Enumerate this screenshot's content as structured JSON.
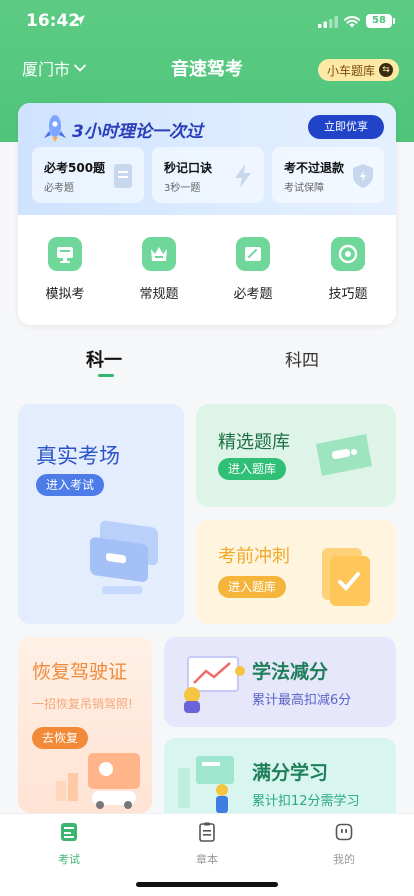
{
  "status": {
    "time": "16:42",
    "battery": "58"
  },
  "header": {
    "city": "厦门市",
    "title": "音速驾考",
    "bank_label": "小车题库"
  },
  "promo": {
    "title": "3小时理论一次过",
    "button": "立即优享",
    "items": [
      {
        "title": "必考500题",
        "sub": "必考题"
      },
      {
        "title": "秒记口诀",
        "sub": "3秒一题"
      },
      {
        "title": "考不过退款",
        "sub": "考试保障"
      }
    ]
  },
  "quick": [
    {
      "label": "模拟考"
    },
    {
      "label": "常规题"
    },
    {
      "label": "必考题"
    },
    {
      "label": "技巧题"
    }
  ],
  "tabs": [
    "科一",
    "科四"
  ],
  "blocks": {
    "real": {
      "title": "真实考场",
      "btn": "进入考试"
    },
    "select": {
      "title": "精选题库",
      "btn": "进入题库"
    },
    "sprint": {
      "title": "考前冲刺",
      "btn": "进入题库"
    },
    "restore": {
      "title": "恢复驾驶证",
      "sub": "一招恢复吊销驾照!",
      "btn": "去恢复"
    },
    "law": {
      "title": "学法减分",
      "sub": "累计最高扣减6分"
    },
    "full": {
      "title": "满分学习",
      "sub": "累计扣12分需学习"
    }
  },
  "tabbar": [
    {
      "label": "考试"
    },
    {
      "label": "章本"
    },
    {
      "label": "我的"
    }
  ],
  "colors": {
    "brand": "#4fc47b",
    "accent_blue": "#2143c8"
  }
}
